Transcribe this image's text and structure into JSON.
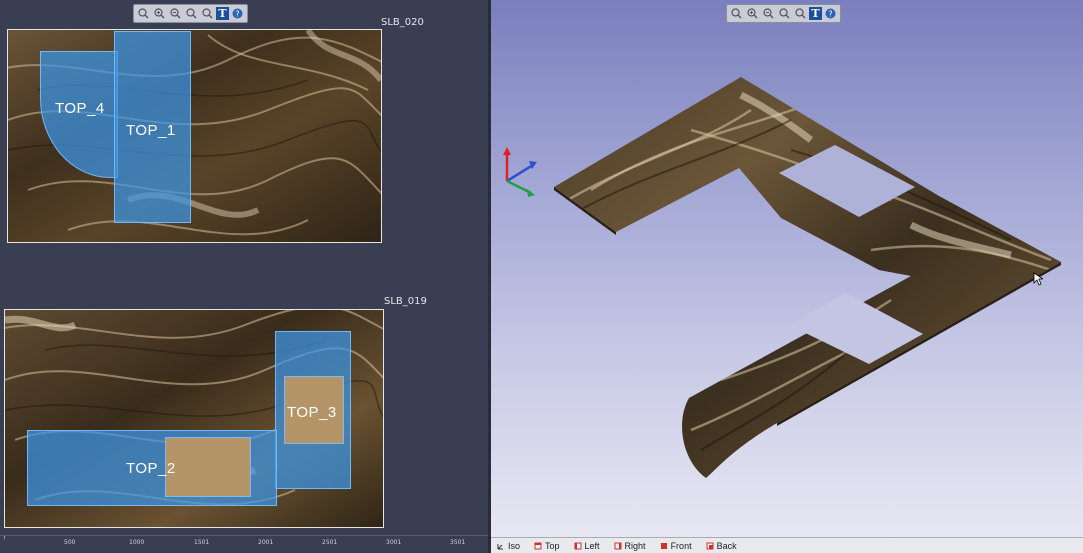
{
  "left_toolbar": {
    "buttons": [
      "zoom-window-icon",
      "zoom-in-icon",
      "zoom-out-icon",
      "zoom-fit-icon",
      "zoom-prev-icon"
    ],
    "text_tool_label": "T",
    "help_icon": "help-icon"
  },
  "right_toolbar": {
    "buttons": [
      "zoom-window-icon",
      "zoom-in-icon",
      "zoom-out-icon",
      "zoom-fit-icon",
      "zoom-prev-icon"
    ],
    "text_tool_label": "T",
    "help_icon": "help-icon"
  },
  "slabs": {
    "top": {
      "label": "SLB_020",
      "pieces": [
        {
          "label": "TOP_4"
        },
        {
          "label": "TOP_1"
        }
      ]
    },
    "bottom": {
      "label": "SLB_019",
      "pieces": [
        {
          "label": "TOP_2"
        },
        {
          "label": "TOP_3"
        }
      ]
    }
  },
  "ruler": {
    "ticks": [
      "500",
      "1000",
      "1501",
      "2001",
      "2501",
      "3001",
      "3501"
    ]
  },
  "view_bar": {
    "buttons": [
      {
        "label": "Iso",
        "icon": "iso-view-icon"
      },
      {
        "label": "Top",
        "icon": "top-view-icon"
      },
      {
        "label": "Left",
        "icon": "left-view-icon"
      },
      {
        "label": "Right",
        "icon": "right-view-icon"
      },
      {
        "label": "Front",
        "icon": "front-view-icon"
      },
      {
        "label": "Back",
        "icon": "back-view-icon"
      }
    ]
  },
  "colors": {
    "piece_fill": "#3c96e6",
    "stone_dark": "#3a2d1c",
    "stone_light": "#d8c39a",
    "panel_bg": "#3a3e52",
    "viewport_top": "#7a7fbd",
    "viewport_bottom": "#eaeaf4"
  }
}
